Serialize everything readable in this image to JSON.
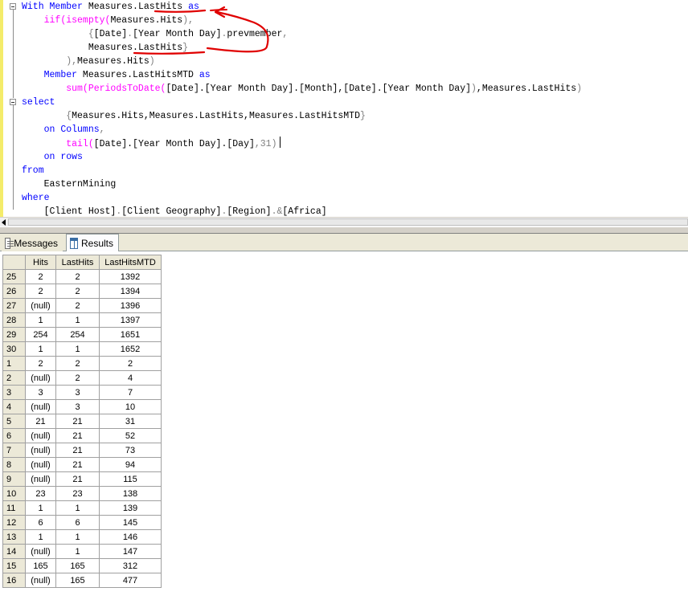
{
  "editor": {
    "lines": [
      {
        "parts": [
          {
            "t": "With",
            "c": "kw"
          },
          {
            "t": " "
          },
          {
            "t": "Member",
            "c": "kw"
          },
          {
            "t": " Measures.LastHits "
          },
          {
            "t": "as",
            "c": "kw"
          }
        ]
      },
      {
        "parts": [
          {
            "t": "    "
          },
          {
            "t": "iif(isempty(",
            "c": "fn"
          },
          {
            "t": "Measures.Hits"
          },
          {
            "t": "),",
            "c": "op"
          }
        ]
      },
      {
        "parts": [
          {
            "t": "            "
          },
          {
            "t": "{",
            "c": "op"
          },
          {
            "t": "[Date]"
          },
          {
            "t": ".",
            "c": "op"
          },
          {
            "t": "[Year Month Day]"
          },
          {
            "t": ".",
            "c": "op"
          },
          {
            "t": "prevmember"
          },
          {
            "t": ",",
            "c": "op"
          }
        ]
      },
      {
        "parts": [
          {
            "t": "            "
          },
          {
            "t": "Measures.LastHits"
          },
          {
            "t": "}",
            "c": "op"
          }
        ]
      },
      {
        "parts": [
          {
            "t": "        "
          },
          {
            "t": "),",
            "c": "op"
          },
          {
            "t": "Measures.Hits"
          },
          {
            "t": ")",
            "c": "op"
          }
        ]
      },
      {
        "parts": [
          {
            "t": "    "
          },
          {
            "t": "Member",
            "c": "kw"
          },
          {
            "t": " Measures.LastHitsMTD "
          },
          {
            "t": "as",
            "c": "kw"
          }
        ]
      },
      {
        "parts": [
          {
            "t": "        "
          },
          {
            "t": "sum(PeriodsToDate(",
            "c": "fn"
          },
          {
            "t": "[Date].[Year Month Day].[Month],[Date].[Year Month Day]"
          },
          {
            "t": ")",
            "c": "op"
          },
          {
            "t": ",Measures.LastHits"
          },
          {
            "t": ")",
            "c": "op"
          }
        ]
      },
      {
        "parts": [
          {
            "t": "select",
            "c": "kw"
          }
        ]
      },
      {
        "parts": [
          {
            "t": "        "
          },
          {
            "t": "{",
            "c": "op"
          },
          {
            "t": "Measures.Hits,Measures.LastHits,Measures.LastHitsMTD"
          },
          {
            "t": "}",
            "c": "op"
          }
        ]
      },
      {
        "parts": [
          {
            "t": "    "
          },
          {
            "t": "on",
            "c": "kw"
          },
          {
            "t": " "
          },
          {
            "t": "Columns",
            "c": "kw"
          },
          {
            "t": ",",
            "c": "op"
          }
        ]
      },
      {
        "parts": [
          {
            "t": "        "
          },
          {
            "t": "tail(",
            "c": "fn"
          },
          {
            "t": "[Date].[Year Month Day].[Day]"
          },
          {
            "t": ",31)",
            "c": "op"
          }
        ],
        "caret": true
      },
      {
        "parts": [
          {
            "t": "    "
          },
          {
            "t": "on",
            "c": "kw"
          },
          {
            "t": " "
          },
          {
            "t": "rows",
            "c": "kw"
          }
        ]
      },
      {
        "parts": [
          {
            "t": "from",
            "c": "kw"
          }
        ]
      },
      {
        "parts": [
          {
            "t": "    EasternMining"
          }
        ]
      },
      {
        "parts": [
          {
            "t": "where",
            "c": "kw"
          }
        ]
      },
      {
        "parts": [
          {
            "t": "    "
          },
          {
            "t": "[Client Host]"
          },
          {
            "t": ".",
            "c": "op"
          },
          {
            "t": "[Client Geography]"
          },
          {
            "t": ".",
            "c": "op"
          },
          {
            "t": "[Region]"
          },
          {
            "t": ".&",
            "c": "op"
          },
          {
            "t": "[Africa]"
          }
        ]
      }
    ]
  },
  "tabs": [
    {
      "label": "Messages",
      "icon": "messages-icon",
      "active": false
    },
    {
      "label": "Results",
      "icon": "results-grid-icon",
      "active": true
    }
  ],
  "results": {
    "columns": [
      "Hits",
      "LastHits",
      "LastHitsMTD"
    ],
    "rows": [
      [
        "25",
        "2",
        "2",
        "1392"
      ],
      [
        "26",
        "2",
        "2",
        "1394"
      ],
      [
        "27",
        "(null)",
        "2",
        "1396"
      ],
      [
        "28",
        "1",
        "1",
        "1397"
      ],
      [
        "29",
        "254",
        "254",
        "1651"
      ],
      [
        "30",
        "1",
        "1",
        "1652"
      ],
      [
        "1",
        "2",
        "2",
        "2"
      ],
      [
        "2",
        "(null)",
        "2",
        "4"
      ],
      [
        "3",
        "3",
        "3",
        "7"
      ],
      [
        "4",
        "(null)",
        "3",
        "10"
      ],
      [
        "5",
        "21",
        "21",
        "31"
      ],
      [
        "6",
        "(null)",
        "21",
        "52"
      ],
      [
        "7",
        "(null)",
        "21",
        "73"
      ],
      [
        "8",
        "(null)",
        "21",
        "94"
      ],
      [
        "9",
        "(null)",
        "21",
        "115"
      ],
      [
        "10",
        "23",
        "23",
        "138"
      ],
      [
        "11",
        "1",
        "1",
        "139"
      ],
      [
        "12",
        "6",
        "6",
        "145"
      ],
      [
        "13",
        "1",
        "1",
        "146"
      ],
      [
        "14",
        "(null)",
        "1",
        "147"
      ],
      [
        "15",
        "165",
        "165",
        "312"
      ],
      [
        "16",
        "(null)",
        "165",
        "477"
      ]
    ]
  },
  "colors": {
    "keyword": "#0000ff",
    "function": "#ff00ff",
    "operator": "#808080",
    "annotation": "#e00000"
  }
}
